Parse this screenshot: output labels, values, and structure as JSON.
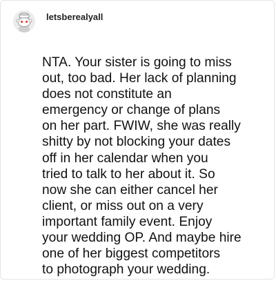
{
  "post": {
    "author": {
      "username": "letsberealyall",
      "avatar_icon": "snoo-avatar-icon"
    },
    "body_lines": [
      "NTA. Your sister is going to miss",
      "out, too bad. Her lack of planning",
      "does not constitute an",
      "emergency or change of plans",
      "on her part. FWIW, she was really",
      "shitty by not blocking your dates",
      "off in her calendar when you",
      "tried to talk to her about it. So",
      "now she can either cancel her",
      "client, or miss out on a very",
      "important family event. Enjoy",
      "your wedding OP. And maybe hire",
      "one of her biggest competitors",
      "to photograph your wedding."
    ]
  },
  "colors": {
    "text": "#111111",
    "username": "#222222",
    "border": "#e5e5e5",
    "avatar_bg": "#e9e9e9"
  }
}
